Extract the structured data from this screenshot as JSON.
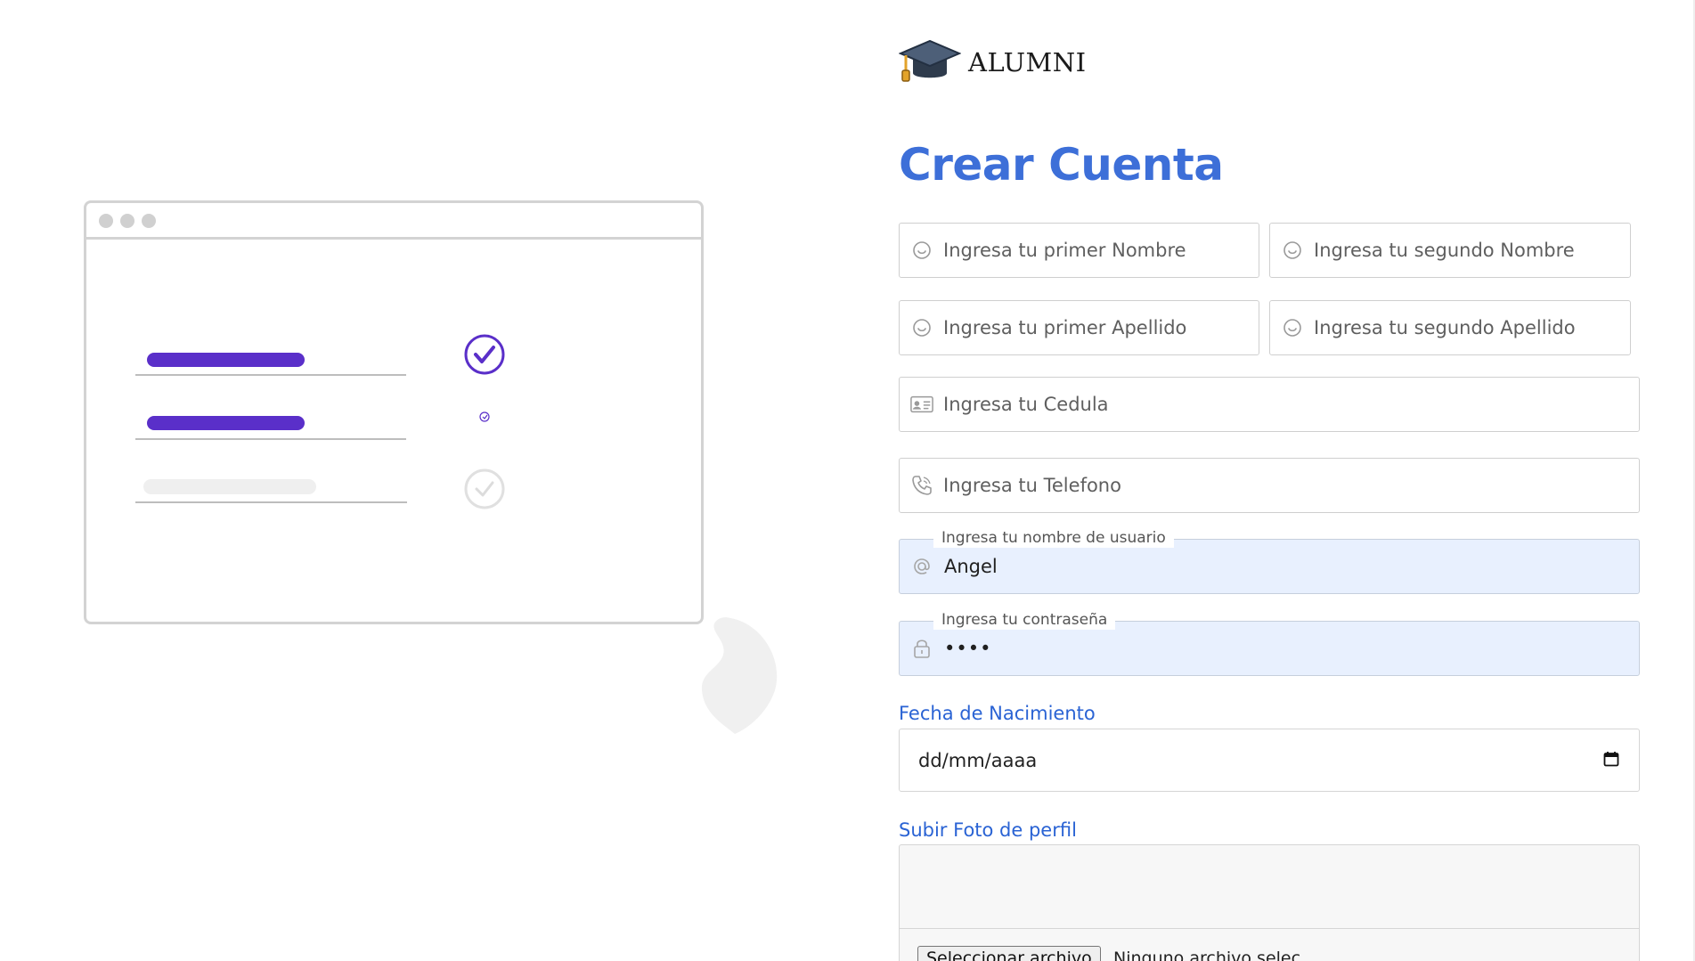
{
  "brand": {
    "name": "ALUMNI"
  },
  "form": {
    "title": "Crear Cuenta",
    "first_name": {
      "placeholder": "Ingresa tu primer Nombre"
    },
    "second_name": {
      "placeholder": "Ingresa tu segundo Nombre"
    },
    "first_surname": {
      "placeholder": "Ingresa tu primer Apellido"
    },
    "second_surname": {
      "placeholder": "Ingresa tu segundo Apellido"
    },
    "cedula": {
      "placeholder": "Ingresa tu Cedula"
    },
    "telefono": {
      "placeholder": "Ingresa tu Telefono"
    },
    "username": {
      "label": "Ingresa tu nombre de usuario",
      "value": "Angel"
    },
    "password": {
      "label": "Ingresa tu contraseña",
      "value": "••••"
    },
    "birthdate": {
      "label": "Fecha de Nacimiento",
      "value": "dd/mm/aaaa"
    },
    "photo": {
      "label": "Subir Foto de perfil",
      "button": "Seleccionar archivo",
      "status": "Ninguno archivo selec"
    }
  },
  "colors": {
    "accent": "#3d6fd8",
    "label_blue": "#2a63d4",
    "illustration_purple": "#5a2fc9",
    "autofill_bg": "#e8f0fe"
  },
  "icons": [
    "graduation-cap-icon",
    "smile-icon",
    "id-card-icon",
    "phone-icon",
    "at-icon",
    "lock-icon",
    "calendar-icon",
    "check-circle-icon"
  ]
}
